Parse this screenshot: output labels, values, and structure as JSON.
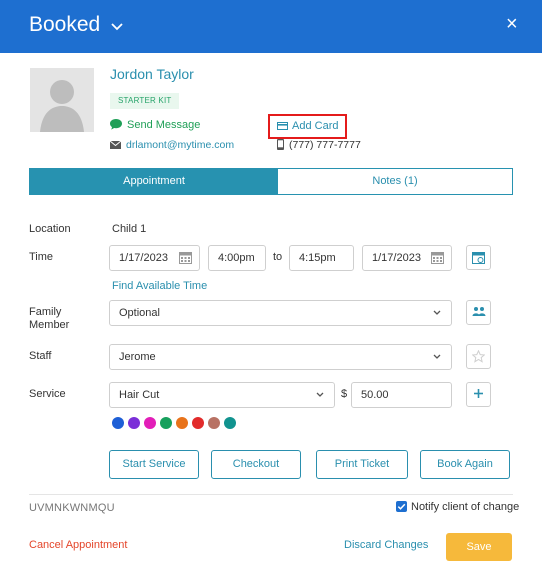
{
  "header": {
    "title": "Booked",
    "close_glyph": "×",
    "chevron_icon": "chevron-down-icon",
    "close_icon": "close-icon"
  },
  "client": {
    "name": "Jordon Taylor",
    "badge": "STARTER KIT",
    "send_message": "Send Message",
    "email": "drlamont@mytime.com",
    "add_card": "Add Card",
    "phone": "(777) 777-7777"
  },
  "tabs": [
    {
      "label": "Appointment"
    },
    {
      "label": "Notes (1)"
    }
  ],
  "form": {
    "location_label": "Location",
    "location_value": "Child 1",
    "time_label": "Time",
    "start_date": "1/17/2023",
    "start_time": "4:00pm",
    "to_label": "to",
    "end_time": "4:15pm",
    "end_date": "1/17/2023",
    "find_time": "Find Available Time",
    "family_label_1": "Family",
    "family_label_2": "Member",
    "family_value": "Optional",
    "staff_label": "Staff",
    "staff_value": "Jerome",
    "service_label": "Service",
    "service_value": "Hair Cut",
    "currency": "$",
    "price": "50.00"
  },
  "colors": [
    "#1e5fd6",
    "#7b2fd8",
    "#e21eb8",
    "#17a05d",
    "#e8731b",
    "#e22b2b",
    "#b87264",
    "#11938f"
  ],
  "actions": {
    "start_service": "Start Service",
    "checkout": "Checkout",
    "print_ticket": "Print Ticket",
    "book_again": "Book Again"
  },
  "footer": {
    "code": "UVMNKWNMQU",
    "notify": "Notify client of change",
    "notify_checked": true,
    "cancel": "Cancel Appointment",
    "discard": "Discard Changes",
    "save": "Save"
  }
}
